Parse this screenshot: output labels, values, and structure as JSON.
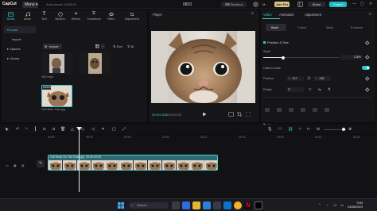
{
  "titlebar": {
    "logo": "CapCut",
    "menu_label": "Menu",
    "autosave": "Auto saved: 09:55:45",
    "project_name": "0810",
    "shortcut_label": "Shortcut",
    "user_name": "M...",
    "joinpro_label": "Join Pro",
    "share_label": "Share",
    "export_label": "Export"
  },
  "media": {
    "tabs": [
      {
        "label": "Media",
        "icon": "media-icon"
      },
      {
        "label": "Audio",
        "icon": "audio-icon"
      },
      {
        "label": "Text",
        "icon": "text-icon"
      },
      {
        "label": "Stickers",
        "icon": "stickers-icon"
      },
      {
        "label": "Effects",
        "icon": "effects-icon"
      },
      {
        "label": "Transitions",
        "icon": "transitions-icon"
      },
      {
        "label": "Filters",
        "icon": "filters-icon"
      },
      {
        "label": "Adjustment",
        "icon": "adjustment-icon"
      }
    ],
    "nav": [
      "Local",
      "Import",
      "Spaces",
      "Library"
    ],
    "import_label": "Import",
    "sort_label": "Sort",
    "all_label": "All",
    "thumbs": [
      {
        "label": "0810.mp4",
        "duration": "00:05"
      },
      {
        "label": "",
        "duration": "00:05"
      },
      {
        "label": "Cat Head...Dele.jpg",
        "badge": "Added"
      }
    ]
  },
  "player": {
    "title": "Player",
    "time_current": "00:00:00:11",
    "time_total": "00:00:02:00"
  },
  "properties": {
    "tabs": [
      "Video",
      "Animation",
      "Adjustment"
    ],
    "subtabs": [
      "Basic",
      "Cutout",
      "Mask",
      "Enhance"
    ],
    "section_title": "Position & Size",
    "scale_label": "Scale",
    "scale_value": "128%",
    "scale_fraction": 0.26,
    "uniform_scale_label": "Uniform scale",
    "position_label": "Position",
    "pos_x_label": "X",
    "pos_x": "-412",
    "pos_y_label": "Y",
    "pos_y": "-185",
    "rotate_label": "Rotate",
    "rotate_value": "0°",
    "blend_label": "Blend",
    "accent": "#34c9d6"
  },
  "timeline": {
    "ruler": [
      "00:00",
      "00:03",
      "00:06",
      "00:09",
      "00:12",
      "00:15",
      "00:18",
      "00:21",
      "00:24"
    ],
    "clip_title": "Cat Head On The Desk.jpg",
    "clip_duration": "00:00:02:00",
    "cover_label": "Cover"
  },
  "taskbar": {
    "search_placeholder": "Search",
    "time": "9:53",
    "date": "04/08/2023"
  }
}
